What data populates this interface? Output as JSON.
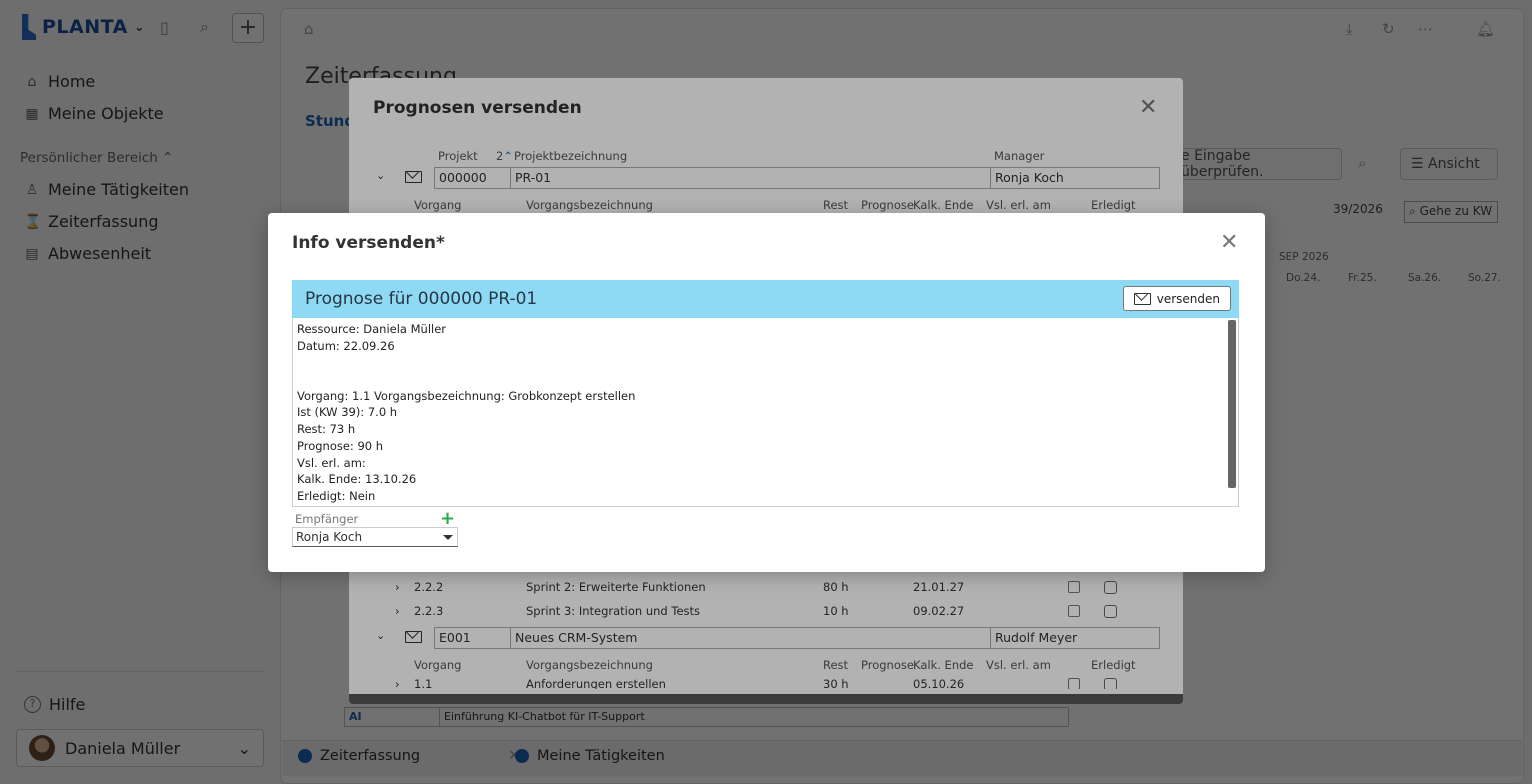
{
  "sidebar": {
    "brand": "PLANTA",
    "nav": [
      {
        "label": "Home",
        "icon": "home-icon"
      },
      {
        "label": "Meine Objekte",
        "icon": "grid-icon"
      }
    ],
    "section": "Persönlicher Bereich",
    "personal": [
      {
        "label": "Meine Tätigkeiten",
        "icon": "person-icon"
      },
      {
        "label": "Zeiterfassung",
        "icon": "hourglass-icon"
      },
      {
        "label": "Abwesenheit",
        "icon": "calendar-icon"
      }
    ],
    "help": "Hilfe",
    "user": "Daniela Müller"
  },
  "main": {
    "title": "Zeiterfassung",
    "tab": "Stunde",
    "toolbar": {
      "check": "e Eingabe überprüfen.",
      "view": "Ansicht",
      "kw": "39/2026",
      "goto": "Gehe zu KW"
    },
    "calendar": {
      "month": "SEP 2026",
      "days": [
        "Do.24.",
        "Fr.25.",
        "Sa.26.",
        "So.27."
      ]
    },
    "back_rows": [
      {
        "code": "AI",
        "name": "Einführung KI-Chatbot für IT-Support"
      }
    ]
  },
  "bottom_tabs": [
    "Zeiterfassung",
    "Meine Tätigkeiten"
  ],
  "dialog_prognosen": {
    "title": "Prognosen versenden",
    "project_headers": {
      "projekt": "Projekt",
      "sort": "2",
      "bez": "Projektbezeichnung",
      "manager": "Manager"
    },
    "task_headers": {
      "vorgang": "Vorgang",
      "bez": "Vorgangsbezeichnung",
      "rest": "Rest",
      "prognose": "Prognose",
      "kalk": "Kalk. Ende",
      "vsl": "Vsl. erl. am",
      "erledigt": "Erledigt"
    },
    "project1": {
      "nr": "000000",
      "name": "PR-01",
      "manager": "Ronja Koch"
    },
    "tasks1": [
      {
        "nr": "2.2.2",
        "name": "Sprint 2: Erweiterte Funktionen",
        "rest": "80 h",
        "kalk": "21.01.27"
      },
      {
        "nr": "2.2.3",
        "name": "Sprint 3: Integration und Tests",
        "rest": "10 h",
        "kalk": "09.02.27"
      }
    ],
    "project2": {
      "nr": "E001",
      "name": "Neues CRM-System",
      "manager": "Rudolf Meyer"
    },
    "tasks2": [
      {
        "nr": "1.1",
        "name": "Anforderungen erstellen",
        "rest": "30 h",
        "kalk": "05.10.26"
      }
    ]
  },
  "dialog_info": {
    "title": "Info versenden*",
    "banner": "Prognose für 000000 PR-01",
    "send_label": "versenden",
    "lines": [
      "Ressource: Daniela Müller",
      "Datum: 22.09.26",
      "",
      "",
      "Vorgang: 1.1  Vorgangsbezeichnung: Grobkonzept erstellen",
      "Ist (KW 39): 7.0 h",
      "Rest: 73 h",
      "Prognose: 90 h",
      "Vsl. erl. am:",
      "Kalk. Ende: 13.10.26",
      "Erledigt: Nein"
    ],
    "recipient_label": "Empfänger",
    "recipient": "Ronja Koch"
  }
}
